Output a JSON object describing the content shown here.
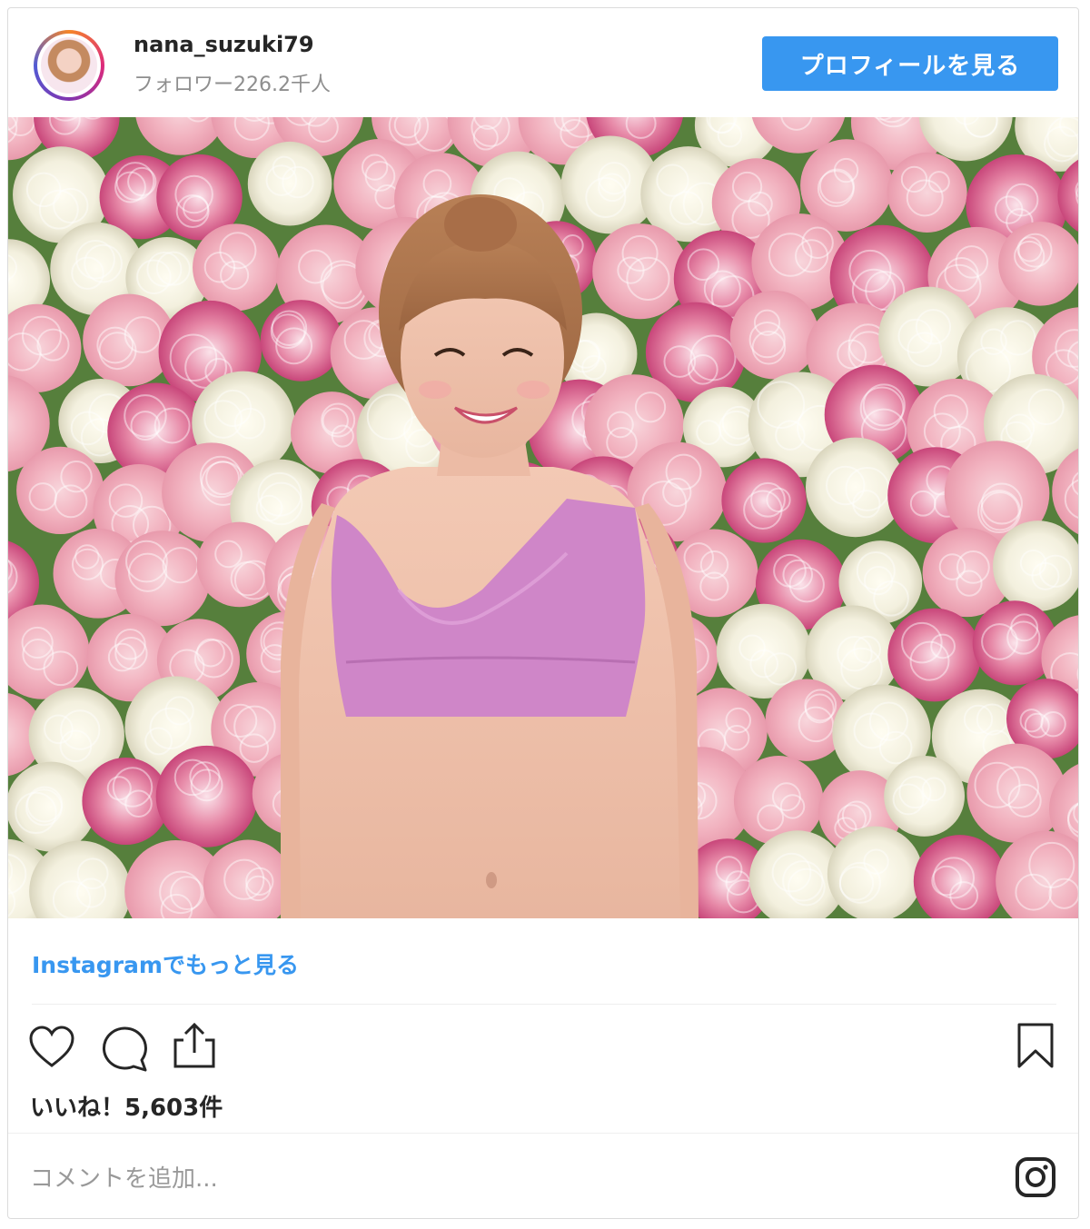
{
  "post": {
    "username": "nana_suzuki79",
    "followers": "フォロワー226.2千人",
    "profile_button": "プロフィールを見る",
    "more_link": "Instagramでもっと見る",
    "likes": "いいね！5,603件",
    "comment_placeholder": "コメントを追加..."
  },
  "colors": {
    "accent": "#3897f0",
    "text": "#262626",
    "muted": "#8e8e8e",
    "bra": "#cf86c8",
    "flower_pink": "#f3bcc6",
    "flower_white": "#f5f3e6",
    "leaf_green": "#4d7a36"
  },
  "icons": [
    "heart-icon",
    "comment-icon",
    "share-icon",
    "bookmark-icon",
    "instagram-icon"
  ]
}
